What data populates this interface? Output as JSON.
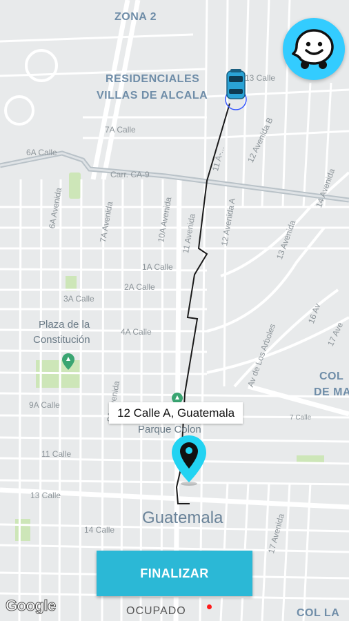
{
  "map": {
    "areas": {
      "zona2": "ZONA 2",
      "residenciales_line1": "RESIDENCIALES",
      "residenciales_line2": "VILLAS DE ALCALA",
      "col_right_1": "COL",
      "col_right_2": "DE MA",
      "col_la": "COL LA"
    },
    "streets": {
      "calle_13_top": "13 Calle",
      "calle_7a": "7A Calle",
      "calle_6a": "6A Calle",
      "carr_ca9": "Carr. CA-9",
      "calle_1a": "1A Calle",
      "calle_2a": "2A Calle",
      "calle_3a": "3A Calle",
      "calle_4a": "4A Calle",
      "calle_9a": "9A Calle",
      "calle_7_right": "7 Calle",
      "calle_11": "11 Calle",
      "calle_13": "13 Calle",
      "calle_14": "14 Calle",
      "av_6a": "6A Avenida",
      "av_7a": "7A Avenida",
      "av_9a": "9A Avenida",
      "av_10a": "10A Avenida",
      "av_11": "11 Avenida",
      "av_11a": "11 A-...",
      "av_12a": "12 Avenida A",
      "av_12b": "12 Avenida B",
      "av_13": "13 Avenida",
      "av_14": "14 Avenida",
      "av_16": "16 Av",
      "av_17": "17 Ave",
      "av_17_bottom": "17 Avenida",
      "av_arboles": "Av de Los Arboles"
    },
    "pois": {
      "plaza_line1": "Plaza de la",
      "plaza_line2": "Constitución",
      "parque_colon": "Parque Colon"
    },
    "city": "Guatemala",
    "attribution": "Google"
  },
  "destination": {
    "label": "12 Calle A, Guatemala"
  },
  "actions": {
    "finish_label": "FINALIZAR"
  },
  "status": {
    "text": "OCUPADO",
    "dot_color": "#ff1a1a"
  },
  "colors": {
    "accent": "#2bb8d6",
    "waze": "#33ccff",
    "pin": "#22d3f2",
    "route": "#1a1a1a"
  },
  "icons": {
    "waze_button": "waze-icon",
    "vehicle": "car-icon",
    "destination": "map-pin-icon",
    "poi": "poi-marker-icon"
  }
}
